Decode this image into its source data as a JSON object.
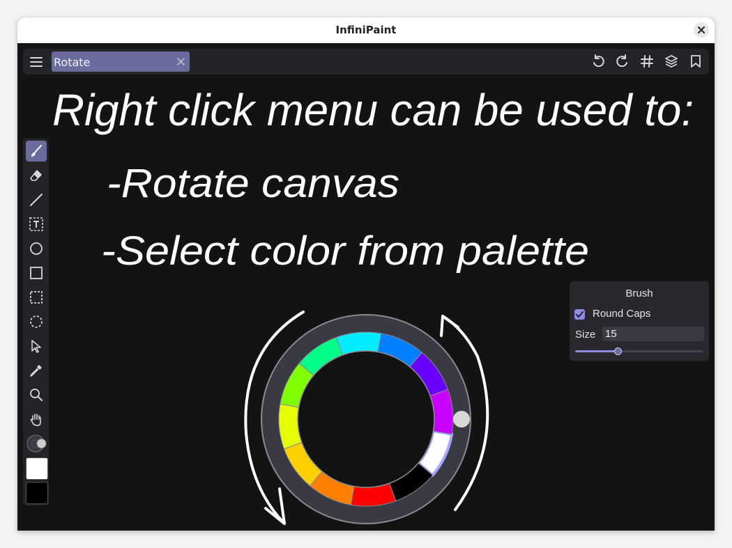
{
  "window": {
    "title": "InfiniPaint"
  },
  "topbar": {
    "tab_label": "Rotate",
    "icons": [
      "menu-icon",
      "undo-icon",
      "redo-icon",
      "grid-icon",
      "layers-icon",
      "bookmark-icon"
    ]
  },
  "toolbar": {
    "tools": [
      "brush-icon",
      "eraser-icon",
      "line-icon",
      "text-icon",
      "ellipse-icon",
      "rectangle-icon",
      "rect-select-icon",
      "lasso-select-icon",
      "pointer-icon",
      "eyedropper-icon",
      "zoom-icon",
      "pan-hand-icon",
      "color-wheel-icon"
    ],
    "active_tool": "brush-icon",
    "primary_color": "#ffffff",
    "secondary_color": "#000000"
  },
  "brush_panel": {
    "title": "Brush",
    "round_caps_label": "Round Caps",
    "round_caps_checked": true,
    "size_label": "Size",
    "size_value": "15",
    "slider_fraction": 0.33
  },
  "handwritten_note": {
    "line1": "Right click menu can be used to:",
    "line2": "-Rotate canvas",
    "line3": "-Select color from palette"
  },
  "palette": {
    "colors": [
      "#ffffff",
      "#000000",
      "#ff0000",
      "#ff8000",
      "#ffd000",
      "#e6ff00",
      "#80ff00",
      "#00ff88",
      "#00ecff",
      "#0080ff",
      "#6a00ff",
      "#c800ff"
    ],
    "selected_color": "#ffffff"
  },
  "colors": {
    "accent": "#6b6b9e",
    "panel": "#232328",
    "canvas": "#131313"
  }
}
